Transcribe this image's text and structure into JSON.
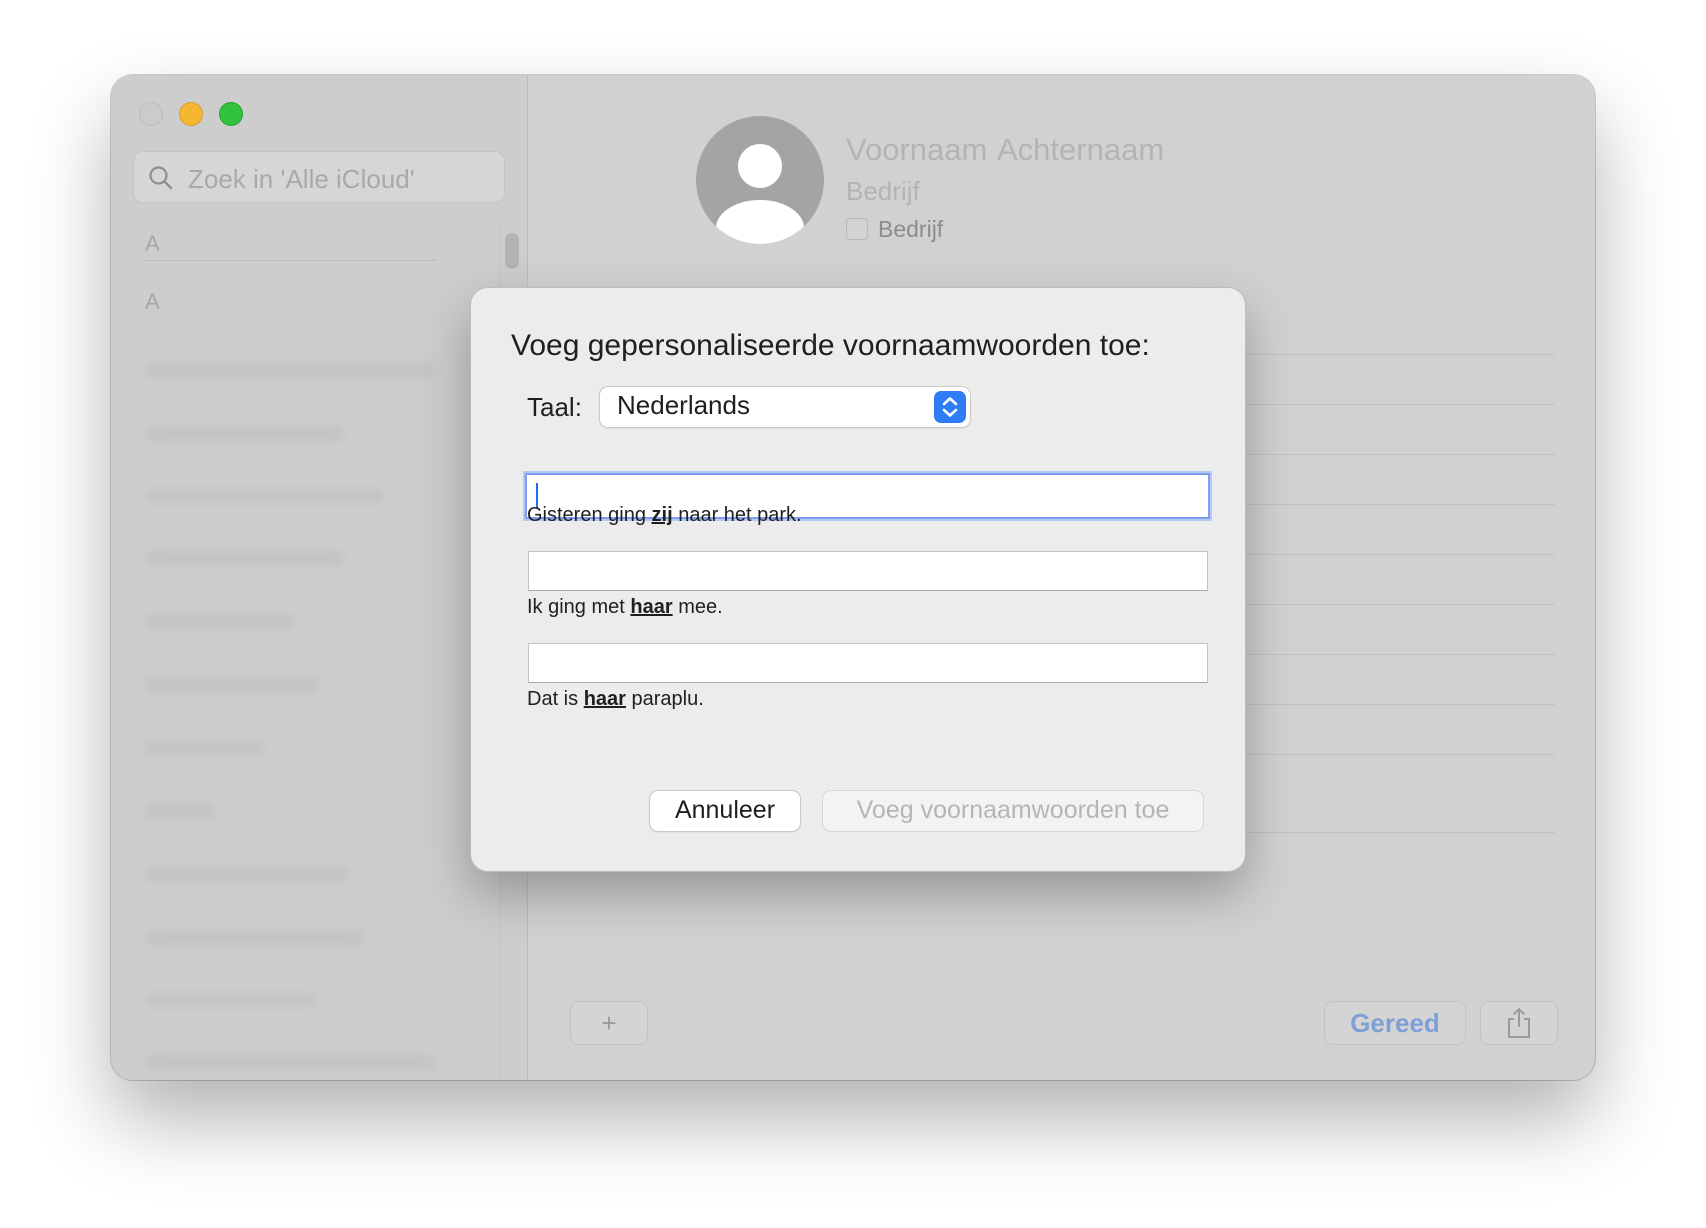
{
  "window": {
    "controls": [
      "close",
      "minimize",
      "zoom"
    ]
  },
  "sidebar": {
    "search_placeholder": "Zoek in 'Alle iCloud'",
    "section_letters": [
      "A",
      "A"
    ]
  },
  "contact_card": {
    "first_name_placeholder": "Voornaam",
    "last_name_placeholder": "Achternaam",
    "company_placeholder": "Bedrijf",
    "company_checkbox_label": "Bedrijf"
  },
  "toolbar": {
    "add_label": "+",
    "done_label": "Gereed",
    "share_icon": "share-icon"
  },
  "dialog": {
    "title": "Voeg gepersonaliseerde voornaamwoorden toe:",
    "language_label": "Taal:",
    "language_value": "Nederlands",
    "fields": [
      {
        "value": "",
        "example_before": "Gisteren ging ",
        "example_pronoun": "zij",
        "example_after": " naar het park."
      },
      {
        "value": "",
        "example_before": "Ik ging met ",
        "example_pronoun": "haar",
        "example_after": " mee."
      },
      {
        "value": "",
        "example_before": "Dat is ",
        "example_pronoun": "haar",
        "example_after": " paraplu."
      }
    ],
    "cancel_label": "Annuleer",
    "add_label": "Voeg voornaamwoorden toe"
  },
  "colors": {
    "accent": "#2f7df6",
    "focus_ring": "#7d9ff1",
    "minimize": "#f5b731",
    "zoom": "#32c33e"
  }
}
